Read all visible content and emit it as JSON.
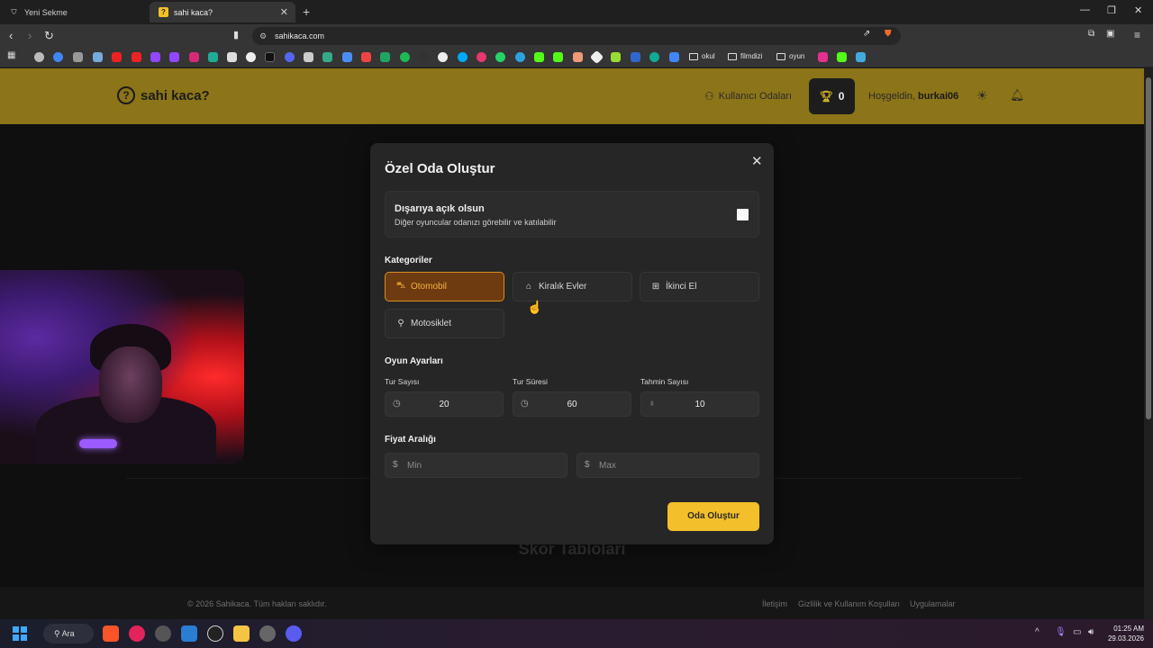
{
  "browser": {
    "tabs": [
      {
        "label": "Yeni Sekme",
        "active": false
      },
      {
        "label": "sahi kaca?",
        "active": true
      }
    ],
    "url": "sahikaca.com",
    "bookmark_folders": [
      "okul",
      "filmdizi",
      "oyun"
    ]
  },
  "header": {
    "logo_text": "sahi kaca?",
    "nav_rooms": "Kullanıcı Odaları",
    "score": "0",
    "welcome_prefix": "Hoşgeldin,",
    "username": "burkai06"
  },
  "modal": {
    "title": "Özel Oda Oluştur",
    "public_title": "Dışarıya açık olsun",
    "public_desc": "Diğer oyuncular odanızı görebilir ve katılabilir",
    "public_checked": false,
    "categories_label": "Kategoriler",
    "categories": [
      {
        "label": "Otomobil",
        "icon": "car-icon",
        "active": true
      },
      {
        "label": "Kiralık Evler",
        "icon": "home-icon",
        "active": false
      },
      {
        "label": "İkinci El",
        "icon": "basket-icon",
        "active": false
      },
      {
        "label": "Motosiklet",
        "icon": "bike-icon",
        "active": false
      }
    ],
    "settings_label": "Oyun Ayarları",
    "settings": [
      {
        "label": "Tur Sayısı",
        "value": "20",
        "icon": "clock-icon"
      },
      {
        "label": "Tur Süresi",
        "value": "60",
        "icon": "clock-icon"
      },
      {
        "label": "Tahmin Sayısı",
        "value": "10",
        "icon": "bulb-icon"
      }
    ],
    "price_label": "Fiyat Aralığı",
    "price_min_placeholder": "Min",
    "price_max_placeholder": "Max",
    "create_button": "Oda Oluştur"
  },
  "page": {
    "score_title": "Skor Tabloları"
  },
  "footer": {
    "copyright": "© 2026 Sahikaca. Tüm hakları saklıdır.",
    "links": [
      "İletişim",
      "Gizlilik ve Kullanım Koşulları",
      "Uygulamalar"
    ]
  },
  "taskbar": {
    "search_label": "Ara",
    "time": "01:25 AM",
    "date": "29.03.2026"
  },
  "colors": {
    "header_bg": "#8c7418",
    "accent": "#f3bf2a",
    "active_category_bg": "#6e3a10",
    "active_category_border": "#d98e22"
  }
}
